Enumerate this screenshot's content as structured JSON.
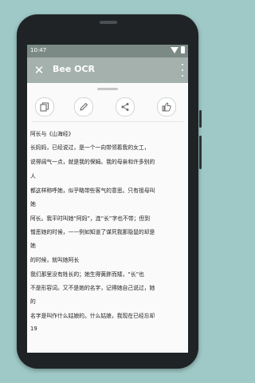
{
  "status": {
    "time": "10:47"
  },
  "app": {
    "title": "Bee OCR"
  },
  "actions": [
    {
      "icon": "copy-icon"
    },
    {
      "icon": "edit-icon"
    },
    {
      "icon": "share-icon"
    },
    {
      "icon": "thumbs-up-icon"
    }
  ],
  "ocr": {
    "lines": [
      "阿长与《山海经》",
      "长妈妈，已经说过，是一个一向带领着我的女工，",
      "说得阔气一点，就是我的保姆。我的母亲和许多别的",
      "人",
      "都这样称呼她，似乎略带些客气的意思。只有祖母叫",
      "她",
      "阿长。我平时叫她“阿妈”，连“长”字也不带；但到",
      "憎恶她的时候，——例如知道了谋死我那隐鼠的却是",
      "她",
      "的时候，就叫她阿长",
      "我们那里没有姓长的；她生得黄胖而矮，“长”也",
      "不是形容词。又不是她的名字，记得她自己说过，她",
      "的",
      "名字是叫作什么姑娘的。什么姑娘，我现在已经忘却",
      "19"
    ]
  },
  "colors": {
    "background": "#9fc9c7",
    "appbar": "#a4b1ad",
    "statusbar": "#7c8a86",
    "phone": "#1f2326"
  }
}
